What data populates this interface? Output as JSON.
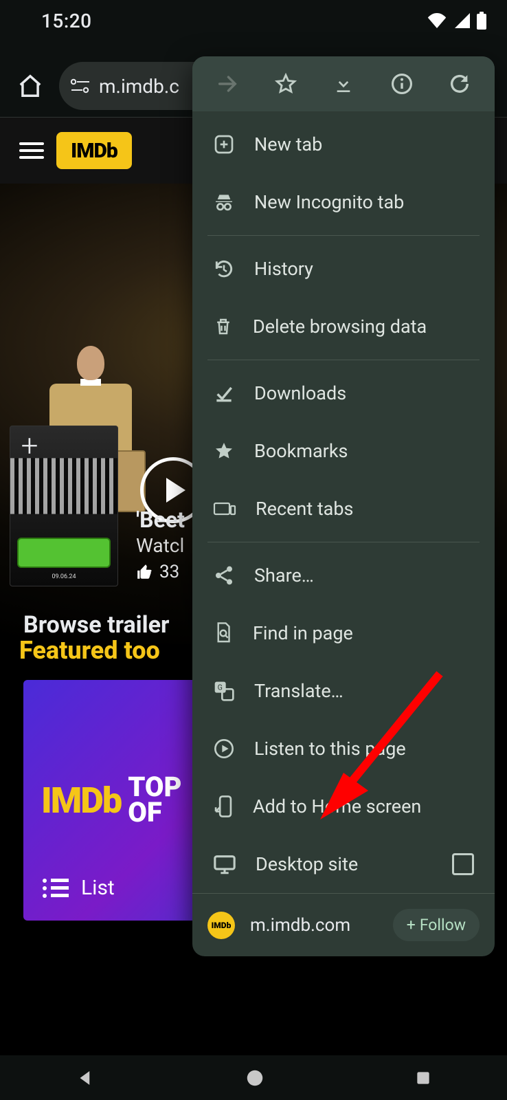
{
  "status": {
    "time": "15:20"
  },
  "chrome": {
    "omnibox": "m.imdb.c"
  },
  "imdb": {
    "logo": "IMDb",
    "hero_title": "'Beet",
    "hero_sub": "Watcl",
    "hero_likes": "33",
    "browse": "Browse trailer",
    "featured": "Featured too",
    "card_logo": "IMDb",
    "card_top": "TOP",
    "card_of": "OF",
    "list": "List"
  },
  "menu": {
    "new_tab": "New tab",
    "incognito": "New Incognito tab",
    "history": "History",
    "delete": "Delete browsing data",
    "downloads": "Downloads",
    "bookmarks": "Bookmarks",
    "recent": "Recent tabs",
    "share": "Share…",
    "find": "Find in page",
    "translate": "Translate…",
    "listen": "Listen to this page",
    "addhome": "Add to Home screen",
    "desktop": "Desktop site",
    "site": "m.imdb.com",
    "follow": "Follow"
  }
}
